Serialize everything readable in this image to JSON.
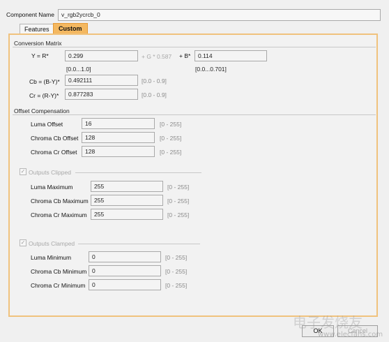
{
  "header": {
    "component_name_label": "Component Name",
    "component_name_value": "v_rgb2ycrcb_0"
  },
  "tabs": [
    {
      "label": "Features"
    },
    {
      "label": "Custom"
    }
  ],
  "conversion_matrix": {
    "title": "Conversion Matrix",
    "y_label": "Y = R*",
    "y_r_value": "0.299",
    "g_text": "+ G * 0.587",
    "b_label": "+ B*",
    "y_b_value": "0.114",
    "r_range": "[0.0...1.0]",
    "b_range": "[0.0...0.701]",
    "cb_label": "Cb = (B-Y)*",
    "cb_value": "0.492111",
    "cb_range": "[0.0 - 0.9]",
    "cr_label": "Cr = (R-Y)*",
    "cr_value": "0.877283",
    "cr_range": "[0.0 - 0.9]"
  },
  "offset_compensation": {
    "title": "Offset Compensation",
    "rows": [
      {
        "label": "Luma Offset",
        "value": "16",
        "range": "[0 - 255]"
      },
      {
        "label": "Chroma Cb Offset",
        "value": "128",
        "range": "[0 - 255]"
      },
      {
        "label": "Chroma Cr Offset",
        "value": "128",
        "range": "[0 - 255]"
      }
    ]
  },
  "outputs_clipped": {
    "label": "Outputs Clipped",
    "checked": true,
    "rows": [
      {
        "label": "Luma Maximum",
        "value": "255",
        "range": "[0 - 255]"
      },
      {
        "label": "Chroma Cb Maximum",
        "value": "255",
        "range": "[0 - 255]"
      },
      {
        "label": "Chroma Cr Maximum",
        "value": "255",
        "range": "[0 - 255]"
      }
    ]
  },
  "outputs_clamped": {
    "label": "Outputs Clamped",
    "checked": true,
    "rows": [
      {
        "label": "Luma Minimum",
        "value": "0",
        "range": "[0 - 255]"
      },
      {
        "label": "Chroma Cb Minimum",
        "value": "0",
        "range": "[0 - 255]"
      },
      {
        "label": "Chroma Cr Minimum",
        "value": "0",
        "range": "[0 - 255]"
      }
    ]
  },
  "footer": {
    "ok_label": "OK",
    "cancel_label": "Cancel"
  },
  "watermark": {
    "text": "电子发烧友",
    "url": "www.elecfans.com"
  },
  "colors": {
    "panel_border": "#f0c27d",
    "active_tab": "#f4b860",
    "disabled_text": "#a8a8a8"
  }
}
